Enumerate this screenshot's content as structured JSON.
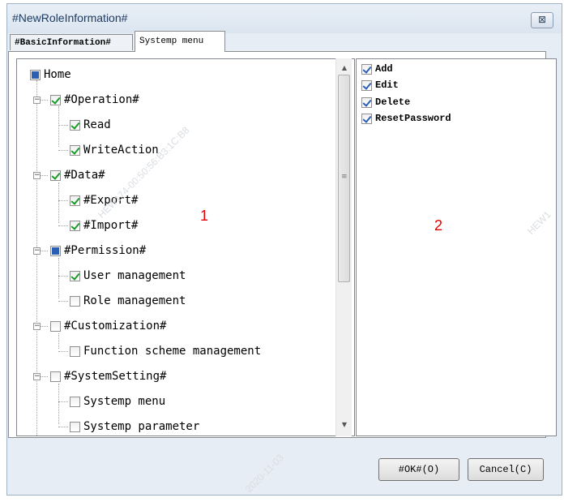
{
  "dialog": {
    "title": "#NewRoleInformation#",
    "close_glyph": "⊠"
  },
  "tabs": [
    {
      "label": "#BasicInformation#",
      "active": false
    },
    {
      "label": "Systemp menu",
      "active": true
    }
  ],
  "tree": {
    "root": {
      "label": "Home",
      "state": "partial"
    },
    "groups": [
      {
        "label": "#Operation#",
        "state": "checked",
        "expanded": true,
        "children": [
          {
            "label": "Read",
            "state": "checked"
          },
          {
            "label": "WriteAction",
            "state": "checked"
          }
        ]
      },
      {
        "label": "#Data#",
        "state": "checked",
        "expanded": true,
        "children": [
          {
            "label": "#Export#",
            "state": "checked"
          },
          {
            "label": "#Import#",
            "state": "checked"
          }
        ]
      },
      {
        "label": "#Permission#",
        "state": "partial",
        "expanded": true,
        "children": [
          {
            "label": "User management",
            "state": "checked"
          },
          {
            "label": "Role management",
            "state": "unchecked"
          }
        ]
      },
      {
        "label": "#Customization#",
        "state": "unchecked",
        "expanded": true,
        "children": [
          {
            "label": "Function scheme management",
            "state": "unchecked"
          }
        ]
      },
      {
        "label": "#SystemSetting#",
        "state": "unchecked",
        "expanded": true,
        "children": [
          {
            "label": "Systemp menu",
            "state": "unchecked"
          },
          {
            "label": "Systemp parameter",
            "state": "unchecked"
          }
        ]
      }
    ]
  },
  "permissions": [
    {
      "label": "Add",
      "state": "checked"
    },
    {
      "label": "Edit",
      "state": "checked"
    },
    {
      "label": "Delete",
      "state": "checked"
    },
    {
      "label": "ResetPassword",
      "state": "checked"
    }
  ],
  "markers": {
    "left": "1",
    "right": "2"
  },
  "buttons": {
    "ok": "#OK#(O)",
    "cancel": "Cancel(C)"
  },
  "watermark": {
    "date": "2020-11-03",
    "code": "HEW174-00:50:56:B3:1C:B8",
    "short": "HEW1"
  },
  "scrollbar": {
    "up": "▲",
    "down": "▼",
    "grip": "≡"
  }
}
